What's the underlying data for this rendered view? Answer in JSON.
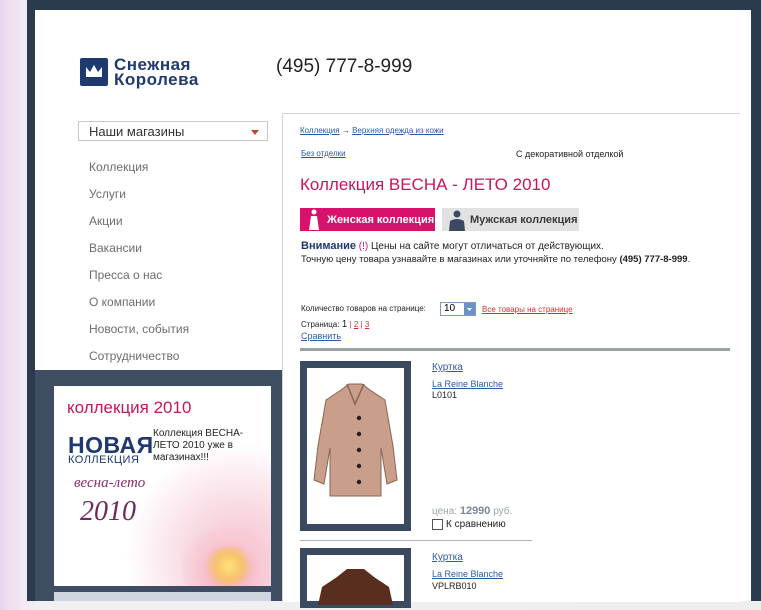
{
  "header": {
    "logo_line1": "Снежная",
    "logo_line2": "Королева",
    "phone": "(495) 777-8-999"
  },
  "sidebar": {
    "stores_select": "Наши магазины",
    "items": [
      {
        "label": "Коллекция"
      },
      {
        "label": "Услуги"
      },
      {
        "label": "Акции"
      },
      {
        "label": "Вакансии"
      },
      {
        "label": "Пресса о нас"
      },
      {
        "label": "О компании"
      },
      {
        "label": "Новости, события"
      },
      {
        "label": "Сотрудничество"
      }
    ]
  },
  "promo": {
    "title": "коллекция 2010",
    "new_word": "НОВАЯ",
    "collection_word": "КОЛЛЕКЦИЯ",
    "text": "Коллекция ВЕСНА-ЛЕТО 2010 уже в магазинах!!!",
    "season": "весна-лето",
    "year": "2010"
  },
  "content": {
    "breadcrumb_1": "Коллекция",
    "breadcrumb_arrow": "→",
    "breadcrumb_2": "Верхняя одежда из кожи",
    "filter_plain": "Без отделки",
    "filter_decor": "С декоративной отделкой",
    "heading": "Коллекция ВЕСНА - ЛЕТО 2010",
    "tab_women": "Женская коллекция",
    "tab_men": "Мужская коллекция",
    "notice_title": "Внимание",
    "notice_mark": "(!)",
    "notice_line1": " Цены на сайте могут отличаться от действующих.",
    "notice_line2_prefix": "Точную цену товара узнавайте в магазинах или уточняйте по телефону ",
    "notice_phone": "(495) 777-8-999",
    "notice_line2_suffix": ".",
    "per_page_label": "Количество товаров на странице:",
    "per_page_value": "10",
    "all_items_link": "Все товары на странице",
    "pages_label": "Страница:",
    "page_current": "1",
    "page_sep": "|",
    "page_2": "2",
    "page_3": "3",
    "compare_link": "Сравнить"
  },
  "products": [
    {
      "title": "Куртка",
      "brand": "La Reine Blanche",
      "code": "L0101",
      "price_label": "цена:",
      "price": "12990",
      "currency": "руб.",
      "compare_label": "К сравнению",
      "color": "#c79a86"
    },
    {
      "title": "Куртка",
      "brand": "La Reine Blanche",
      "code": "VPLRB010",
      "color": "#5a2e1e"
    }
  ],
  "colors": {
    "accent_pink": "#d8126c",
    "navy": "#1e3873",
    "frame": "#2b3a4e"
  }
}
